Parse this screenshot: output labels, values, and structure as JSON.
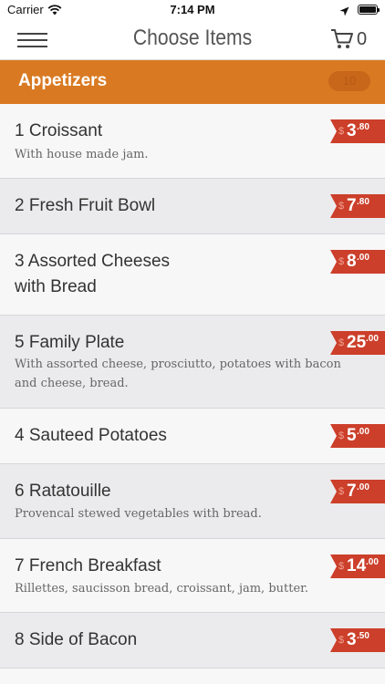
{
  "status_bar": {
    "carrier": "Carrier",
    "time": "7:14 PM"
  },
  "nav": {
    "title": "Choose Items",
    "cart_count": "0"
  },
  "section": {
    "title": "Appetizers",
    "count": "10"
  },
  "colors": {
    "accent": "#d97a22",
    "price_tag": "#cc3f2a"
  },
  "icons": {
    "menu": "hamburger-icon",
    "cart": "cart-icon",
    "wifi": "wifi-icon",
    "location": "location-arrow-icon",
    "battery": "battery-icon"
  },
  "items": [
    {
      "name": "1 Croissant",
      "desc": "With house made jam.",
      "dollar": "$",
      "price_main": "3",
      "price_cents": ".80"
    },
    {
      "name": "2 Fresh Fruit Bowl",
      "desc": "",
      "dollar": "$",
      "price_main": "7",
      "price_cents": ".80"
    },
    {
      "name": "3 Assorted Cheeses with Bread",
      "desc": "",
      "dollar": "$",
      "price_main": "8",
      "price_cents": ".00"
    },
    {
      "name": "5 Family Plate",
      "desc": "With assorted cheese, prosciutto, potatoes with bacon and cheese, bread.",
      "dollar": "$",
      "price_main": "25",
      "price_cents": ".00"
    },
    {
      "name": "4 Sauteed Potatoes",
      "desc": "",
      "dollar": "$",
      "price_main": "5",
      "price_cents": ".00"
    },
    {
      "name": "6 Ratatouille",
      "desc": "Provencal stewed vegetables with bread.",
      "dollar": "$",
      "price_main": "7",
      "price_cents": ".00"
    },
    {
      "name": "7 French Breakfast",
      "desc": "Rillettes, saucisson bread, croissant, jam, butter.",
      "dollar": "$",
      "price_main": "14",
      "price_cents": ".00"
    },
    {
      "name": "8 Side of Bacon",
      "desc": "",
      "dollar": "$",
      "price_main": "3",
      "price_cents": ".50"
    }
  ]
}
